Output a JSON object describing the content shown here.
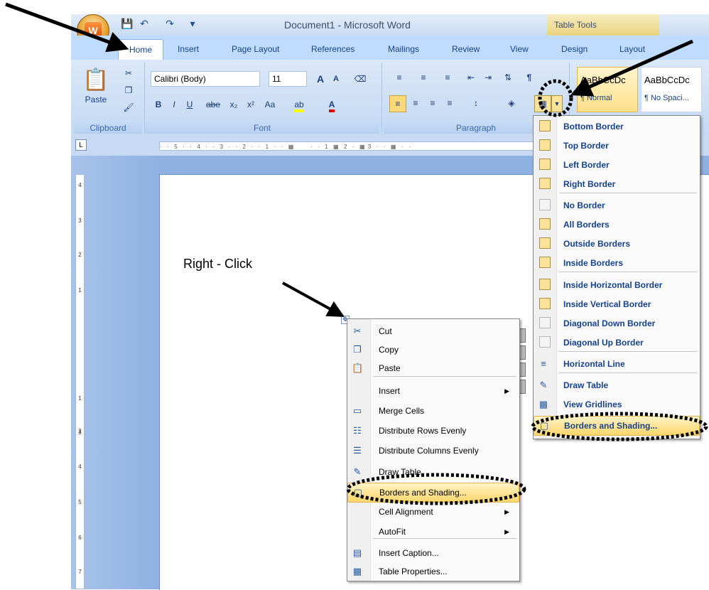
{
  "window": {
    "title": "Document1 - Microsoft Word",
    "contextual_tab_group": "Table Tools",
    "office_button_glyph": "W",
    "quick_access": [
      "save-icon",
      "undo-icon",
      "redo-icon",
      "customize-icon"
    ]
  },
  "tabs": [
    "Home",
    "Insert",
    "Page Layout",
    "References",
    "Mailings",
    "Review",
    "View",
    "Design",
    "Layout"
  ],
  "ribbon": {
    "clipboard": {
      "label": "Clipboard",
      "paste": "Paste"
    },
    "font": {
      "label": "Font",
      "font_name": "Calibri (Body)",
      "font_size": "11",
      "bold": "B",
      "italic": "I",
      "underline": "U",
      "strikethrough": "abe",
      "subscript": "x₂",
      "superscript": "x²",
      "change_case": "Aa",
      "grow": "A",
      "shrink": "A"
    },
    "paragraph": {
      "label": "Paragraph"
    },
    "styles": [
      {
        "preview": "AaBbCcDc",
        "name": "¶ Normal"
      },
      {
        "preview": "AaBbCcDc",
        "name": "¶ No Spaci..."
      }
    ]
  },
  "ruler": {
    "corner": "L",
    "horizontal_marks": "·  ·  5  ·  ·  4  ·  ·  3  ·  ·  2  ·  ·  1  ·  ·  ▦       ·  ·  1  ▦  2  ·  ▦ 3  ·  ·  ▦  ·  ·",
    "vertical_numbers": [
      "4",
      "3",
      "2",
      "1",
      "1",
      "2",
      "3",
      "4",
      "5",
      "6",
      "7"
    ]
  },
  "annotation": {
    "label": "Right - Click"
  },
  "context_menu": [
    {
      "label": "Cut",
      "icon": "scissors-icon",
      "arrow": false
    },
    {
      "label": "Copy",
      "icon": "copy-icon",
      "arrow": false
    },
    {
      "label": "Paste",
      "icon": "paste-icon",
      "arrow": false
    },
    {
      "label": "Insert",
      "icon": "",
      "arrow": true
    },
    {
      "label": "Merge Cells",
      "icon": "merge-cells-icon",
      "arrow": false
    },
    {
      "label": "Distribute Rows Evenly",
      "icon": "distribute-rows-icon",
      "arrow": false
    },
    {
      "label": "Distribute Columns Evenly",
      "icon": "distribute-columns-icon",
      "arrow": false
    },
    {
      "label": "Draw Table",
      "icon": "draw-table-icon",
      "arrow": false
    },
    {
      "label": "Borders and Shading...",
      "icon": "borders-shading-icon",
      "arrow": false,
      "highlighted": true
    },
    {
      "label": "Cell Alignment",
      "icon": "",
      "arrow": true
    },
    {
      "label": "AutoFit",
      "icon": "",
      "arrow": true
    },
    {
      "label": "Insert Caption...",
      "icon": "caption-icon",
      "arrow": false
    },
    {
      "label": "Table Properties...",
      "icon": "table-properties-icon",
      "arrow": false
    }
  ],
  "borders_menu": [
    {
      "label": "Bottom Border",
      "icon": "bottom-border-icon"
    },
    {
      "label": "Top Border",
      "icon": "top-border-icon"
    },
    {
      "label": "Left Border",
      "icon": "left-border-icon"
    },
    {
      "label": "Right Border",
      "icon": "right-border-icon"
    },
    {
      "label": "No Border",
      "icon": "no-border-icon"
    },
    {
      "label": "All Borders",
      "icon": "all-borders-icon"
    },
    {
      "label": "Outside Borders",
      "icon": "outside-borders-icon"
    },
    {
      "label": "Inside Borders",
      "icon": "inside-borders-icon"
    },
    {
      "label": "Inside Horizontal Border",
      "icon": "inside-horizontal-border-icon"
    },
    {
      "label": "Inside Vertical Border",
      "icon": "inside-vertical-border-icon"
    },
    {
      "label": "Diagonal Down Border",
      "icon": "diagonal-down-border-icon"
    },
    {
      "label": "Diagonal Up Border",
      "icon": "diagonal-up-border-icon"
    },
    {
      "label": "Horizontal Line",
      "icon": "horizontal-line-icon"
    },
    {
      "label": "Draw Table",
      "icon": "draw-table-icon"
    },
    {
      "label": "View Gridlines",
      "icon": "view-gridlines-icon"
    },
    {
      "label": "Borders and Shading...",
      "icon": "borders-shading-icon",
      "highlighted": true
    }
  ]
}
